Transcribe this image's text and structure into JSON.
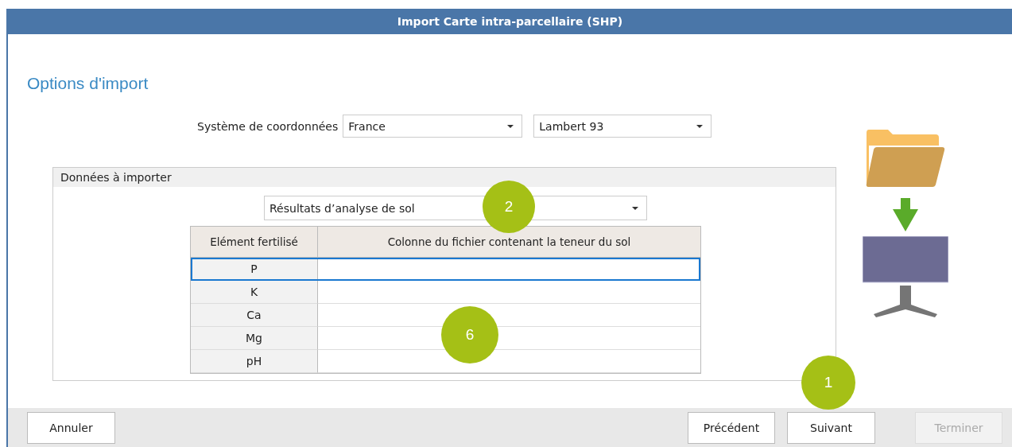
{
  "window": {
    "title": "Import Carte intra-parcellaire (SHP)"
  },
  "heading": "Options d'import",
  "coordinates": {
    "label": "Système de coordonnées",
    "fields": [
      {
        "value": "France"
      },
      {
        "value": "Lambert 93"
      }
    ]
  },
  "import_data": {
    "title": "Données à importer",
    "data_type": {
      "value": "Résultats d’analyse de sol"
    },
    "table": {
      "columns": [
        "Elément fertilisé",
        "Colonne du fichier contenant la teneur du sol"
      ],
      "rows": [
        {
          "element": "P",
          "selected": true
        },
        {
          "element": "K",
          "selected": false
        },
        {
          "element": "Ca",
          "selected": false
        },
        {
          "element": "Mg",
          "selected": false
        },
        {
          "element": "pH",
          "selected": false
        }
      ]
    }
  },
  "buttons": [
    {
      "label": "Annuler",
      "disabled": false
    },
    {
      "label": "Précédent",
      "disabled": false
    },
    {
      "label": "Suivant",
      "disabled": false
    },
    {
      "label": "Terminer",
      "disabled": true
    }
  ],
  "callouts": [
    {
      "number": "2"
    },
    {
      "number": "6"
    },
    {
      "number": "1"
    }
  ]
}
